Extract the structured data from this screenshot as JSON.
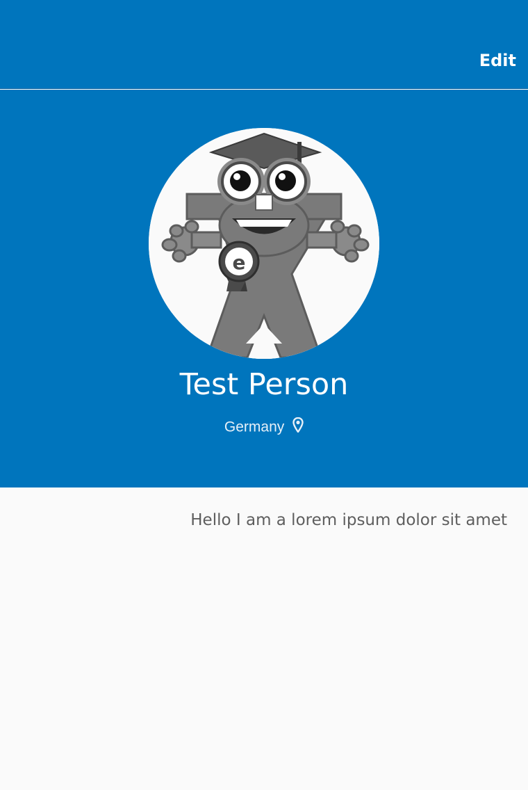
{
  "nav": {
    "edit_label": "Edit"
  },
  "profile": {
    "name": "Test Person",
    "location": "Germany",
    "location_icon": "map-pin-icon",
    "avatar_icon": "mascot-avatar",
    "bio": "Hello I am a lorem ipsum dolor sit amet"
  },
  "colors": {
    "header_blue": "#0075bd",
    "background": "#fafafa",
    "bio_text": "#5e5e5e"
  }
}
